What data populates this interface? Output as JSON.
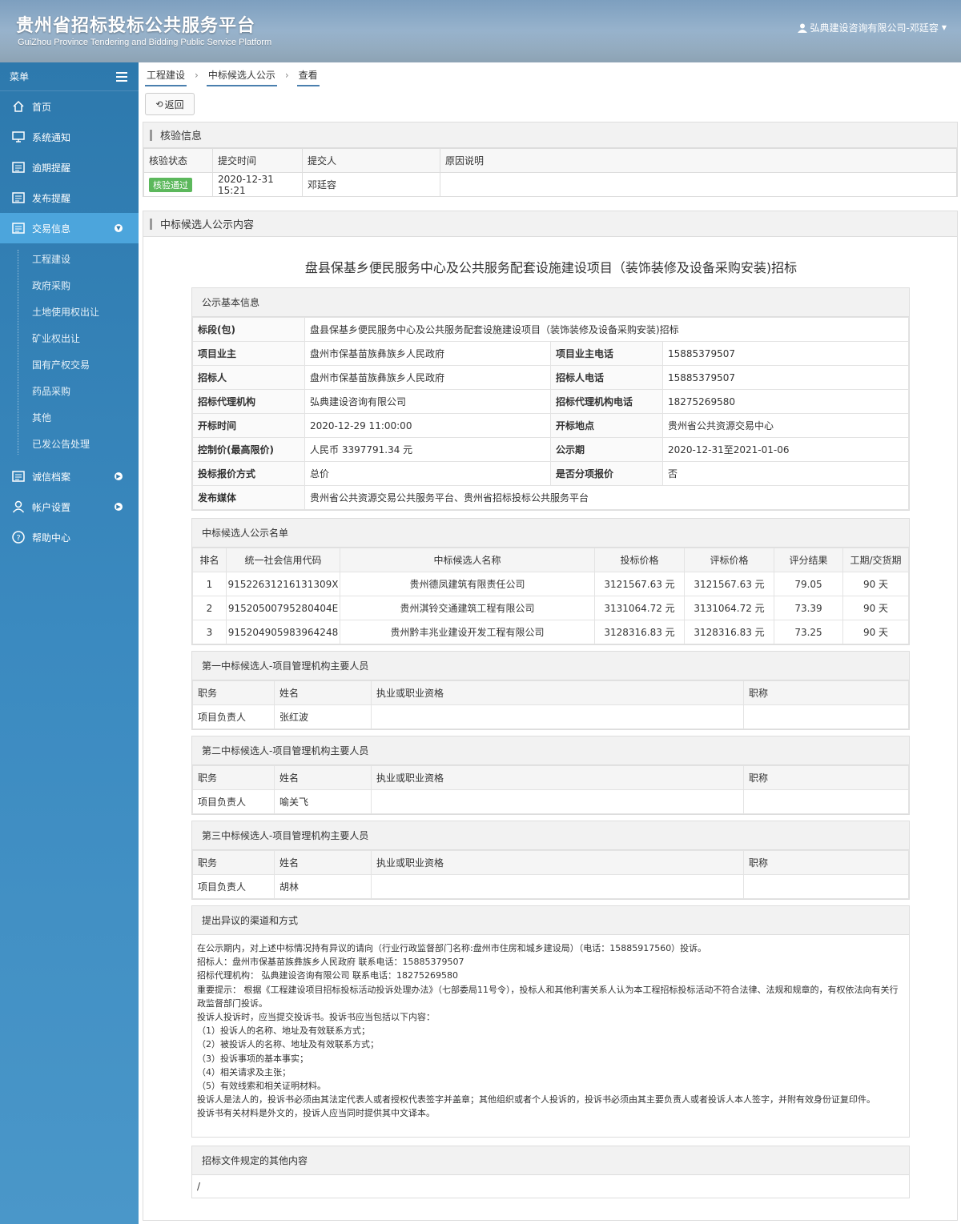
{
  "header": {
    "title_cn": "贵州省招标投标公共服务平台",
    "title_en": "GuiZhou Province Tendering and Bidding Public Service Platform",
    "user": "弘典建设咨询有限公司-邓廷容"
  },
  "sidebar": {
    "menu_label": "菜单",
    "items": [
      {
        "label": "首页"
      },
      {
        "label": "系统通知"
      },
      {
        "label": "逾期提醒"
      },
      {
        "label": "发布提醒"
      },
      {
        "label": "交易信息"
      },
      {
        "label": "诚信档案"
      },
      {
        "label": "帐户设置"
      },
      {
        "label": "帮助中心"
      }
    ],
    "sub_items": [
      "工程建设",
      "政府采购",
      "土地使用权出让",
      "矿业权出让",
      "国有产权交易",
      "药品采购",
      "其他",
      "已发公告处理"
    ]
  },
  "breadcrumb": [
    "工程建设",
    "中标候选人公示",
    "查看"
  ],
  "back_label": "返回",
  "verify": {
    "title": "核验信息",
    "headers": [
      "核验状态",
      "提交时间",
      "提交人",
      "原因说明"
    ],
    "status": "核验通过",
    "time": "2020-12-31 15:21",
    "person": "邓廷容",
    "reason": ""
  },
  "content": {
    "panel_title": "中标候选人公示内容",
    "project_title": "盘县保基乡便民服务中心及公共服务配套设施建设项目（装饰装修及设备采购安装)招标",
    "basic": {
      "title": "公示基本信息",
      "section_k": "标段(包)",
      "section_v": "盘县保基乡便民服务中心及公共服务配套设施建设项目（装饰装修及设备采购安装)招标",
      "rows": [
        {
          "k1": "项目业主",
          "v1": "盘州市保基苗族彝族乡人民政府",
          "k2": "项目业主电话",
          "v2": "15885379507"
        },
        {
          "k1": "招标人",
          "v1": "盘州市保基苗族彝族乡人民政府",
          "k2": "招标人电话",
          "v2": "15885379507"
        },
        {
          "k1": "招标代理机构",
          "v1": "弘典建设咨询有限公司",
          "k2": "招标代理机构电话",
          "v2": "18275269580"
        },
        {
          "k1": "开标时间",
          "v1": "2020-12-29 11:00:00",
          "k2": "开标地点",
          "v2": "贵州省公共资源交易中心"
        },
        {
          "k1": "控制价(最高限价)",
          "v1": "人民币 3397791.34 元",
          "k2": "公示期",
          "v2": "2020-12-31至2021-01-06"
        },
        {
          "k1": "投标报价方式",
          "v1": "总价",
          "k2": "是否分项报价",
          "v2": "否"
        }
      ],
      "media_k": "发布媒体",
      "media_v": "贵州省公共资源交易公共服务平台、贵州省招标投标公共服务平台"
    },
    "candidates": {
      "title": "中标候选人公示名单",
      "headers": [
        "排名",
        "统一社会信用代码",
        "中标候选人名称",
        "投标价格",
        "评标价格",
        "评分结果",
        "工期/交货期"
      ],
      "rows": [
        [
          "1",
          "91522631216131309X",
          "贵州德凤建筑有限责任公司",
          "3121567.63 元",
          "3121567.63 元",
          "79.05",
          "90 天"
        ],
        [
          "2",
          "91520500795280404E",
          "贵州淇铃交通建筑工程有限公司",
          "3131064.72 元",
          "3131064.72 元",
          "73.39",
          "90 天"
        ],
        [
          "3",
          "915204905983964248",
          "贵州黔丰兆业建设开发工程有限公司",
          "3128316.83 元",
          "3128316.83 元",
          "73.25",
          "90 天"
        ]
      ]
    },
    "personnel": [
      {
        "title": "第一中标候选人-项目管理机构主要人员",
        "role": "项目负责人",
        "name": "张红波"
      },
      {
        "title": "第二中标候选人-项目管理机构主要人员",
        "role": "项目负责人",
        "name": "喻关飞"
      },
      {
        "title": "第三中标候选人-项目管理机构主要人员",
        "role": "项目负责人",
        "name": "胡林"
      }
    ],
    "personnel_headers": [
      "职务",
      "姓名",
      "执业或职业资格",
      "职称"
    ],
    "objection": {
      "title": "提出异议的渠道和方式",
      "lines": [
        "在公示期内，对上述中标情况持有异议的请向（行业行政监督部门名称:盘州市住房和城乡建设局）（电话：15885917560）投诉。",
        "招标人：盘州市保基苗族彝族乡人民政府 联系电话：15885379507",
        "招标代理机构： 弘典建设咨询有限公司 联系电话：18275269580",
        "重要提示： 根据《工程建设项目招标投标活动投诉处理办法》（七部委局11号令），投标人和其他利害关系人认为本工程招标投标活动不符合法律、法规和规章的，有权依法向有关行政监督部门投诉。",
        "投诉人投诉时，应当提交投诉书。投诉书应当包括以下内容：",
        "（1）投诉人的名称、地址及有效联系方式；",
        "（2）被投诉人的名称、地址及有效联系方式；",
        "（3）投诉事项的基本事实；",
        "（4）相关请求及主张；",
        "（5）有效线索和相关证明材料。",
        "投诉人是法人的，投诉书必须由其法定代表人或者授权代表签字并盖章；其他组织或者个人投诉的，投诉书必须由其主要负责人或者投诉人本人签字，并附有效身份证复印件。",
        "投诉书有关材料是外文的，投诉人应当同时提供其中文译本。"
      ]
    },
    "other": {
      "title": "招标文件规定的其他内容",
      "value": "/"
    }
  }
}
